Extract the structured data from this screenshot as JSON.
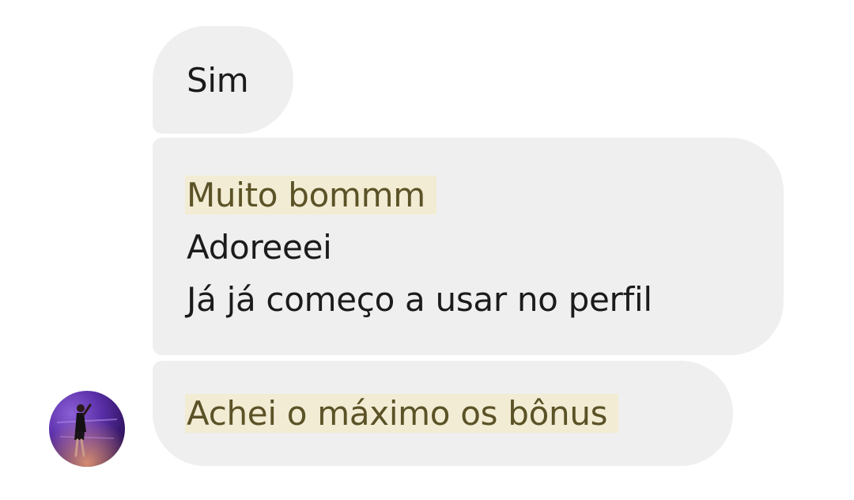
{
  "messages": [
    {
      "lines": [
        {
          "text": "Sim",
          "highlighted": false
        }
      ]
    },
    {
      "lines": [
        {
          "text": "Muito bommm",
          "highlighted": true
        },
        {
          "text": "Adoreeei",
          "highlighted": false
        },
        {
          "text": "Já já começo a usar no perfil",
          "highlighted": false
        }
      ]
    },
    {
      "lines": [
        {
          "text": "Achei o máximo os bônus",
          "highlighted": true
        }
      ]
    }
  ],
  "colors": {
    "bubble": "#efefef",
    "highlight": "#f2ecd4",
    "highlight_text": "#5b5227",
    "text": "#1b1b1b"
  },
  "avatar": {
    "icon": "person-photo-icon"
  }
}
